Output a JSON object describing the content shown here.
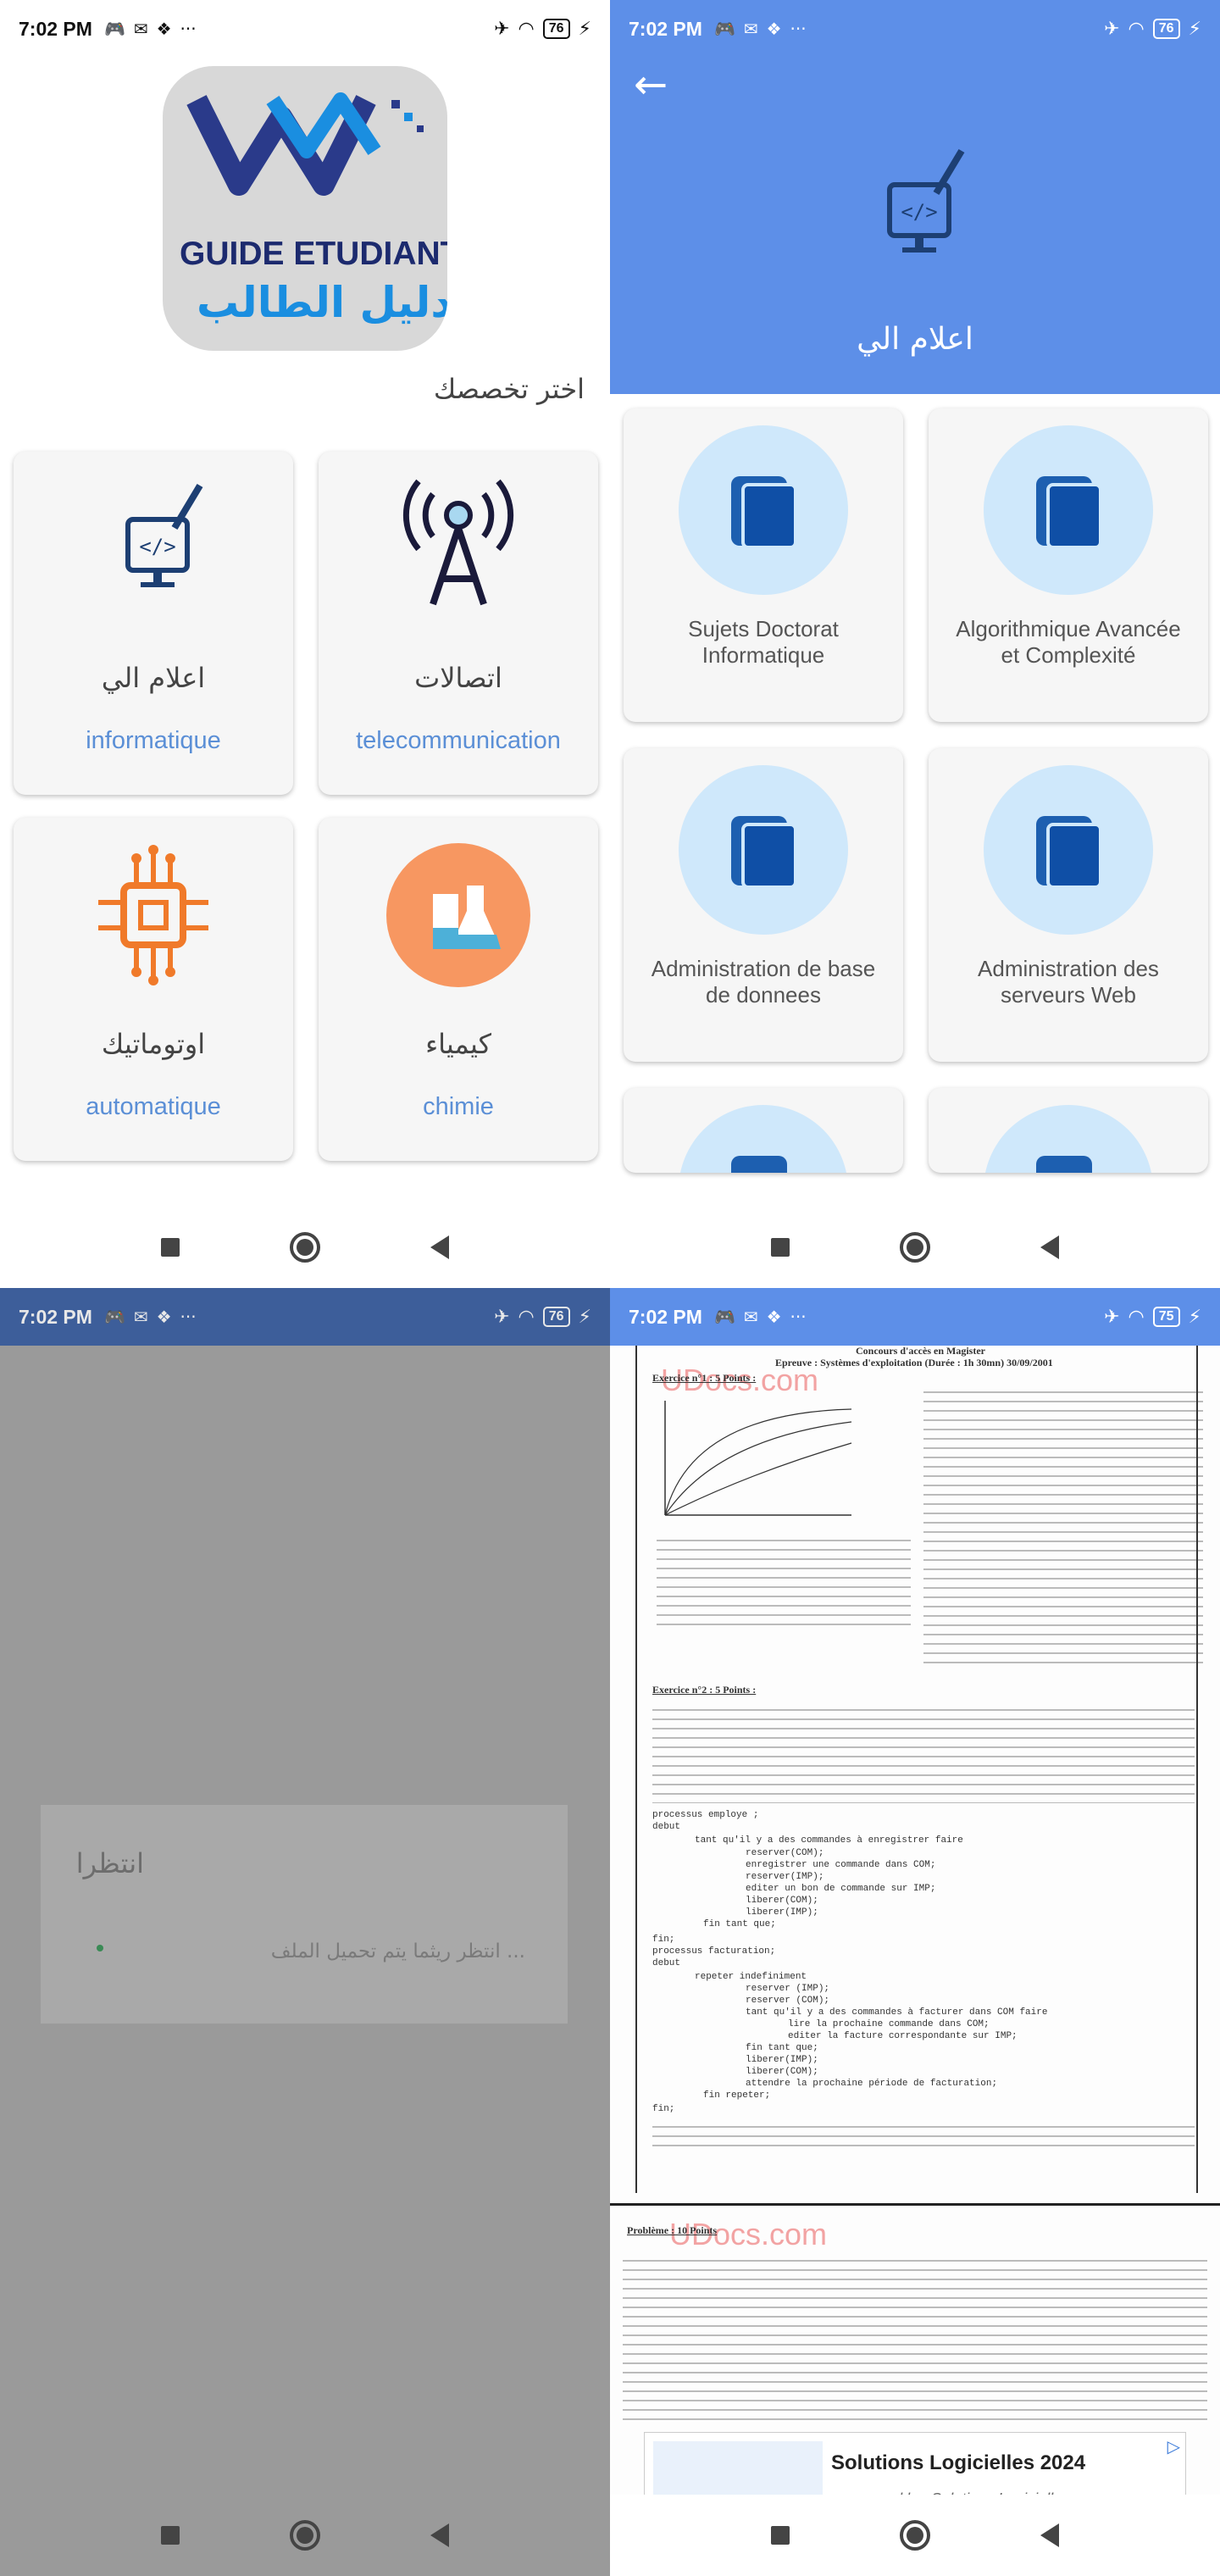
{
  "status": {
    "time": "7:02 PM",
    "battery_s1": "76",
    "battery_s2": "76",
    "battery_s3": "76",
    "battery_s4": "75",
    "dots": "···"
  },
  "home": {
    "logo_line1": "GUIDE ETUDIANT",
    "logo_line2": "دليل الطالب",
    "choose_title": "اختر تخصصك",
    "cards": [
      {
        "ar": "اعلام الي",
        "en": "informatique"
      },
      {
        "ar": "اتصالات",
        "en": "telecommunication"
      },
      {
        "ar": "اوتوماتيك",
        "en": "automatique"
      },
      {
        "ar": "كيمياء",
        "en": "chimie"
      }
    ]
  },
  "subjects": {
    "title": "اعلام الي",
    "items": [
      {
        "label": "Sujets Doctorat Informatique"
      },
      {
        "label": "Algorithmique Avancée et Complexité"
      },
      {
        "label": "Administration de base de donnees"
      },
      {
        "label": "Administration des serveurs Web"
      }
    ]
  },
  "loading": {
    "title": "انتظرا",
    "message": "انتظر ريثما يتم تحميل الملف ..."
  },
  "document": {
    "watermark": "UDocs.com",
    "heading1": "Concours d'accès en Magister",
    "heading2": "Epreuve : Systèmes d'exploitation (Durée : 1h 30mn) 30/09/2001",
    "ex1": "Exercice n°1 : 5 Points :",
    "ex2": "Exercice n°2 : 5 Points :",
    "problem": "Problème : 10 Points",
    "code_lines": [
      "processus employe ;",
      "debut",
      "tant qu'il y a des commandes à enregistrer faire",
      "reserver(COM);",
      "enregistrer une commande dans COM;",
      "reserver(IMP);",
      "editer un bon de commande sur IMP;",
      "liberer(COM);",
      "liberer(IMP);",
      "fin tant que;",
      "fin;",
      "processus facturation;",
      "debut",
      "repeter indefiniment",
      "reserver (IMP);",
      "reserver (COM);",
      "tant qu'il y a des commandes à facturer dans COM faire",
      "lire la prochaine commande dans COM;",
      "editer la facture correspondante sur IMP;",
      "fin tant que;",
      "liberer(IMP);",
      "liberer(COM);",
      "attendre la prochaine période de facturation;",
      "fin repeter;",
      "fin;"
    ]
  },
  "ad": {
    "title": "Solutions Logicielles 2024",
    "sponsor": "sponsored by: Solutions Logicielles"
  }
}
